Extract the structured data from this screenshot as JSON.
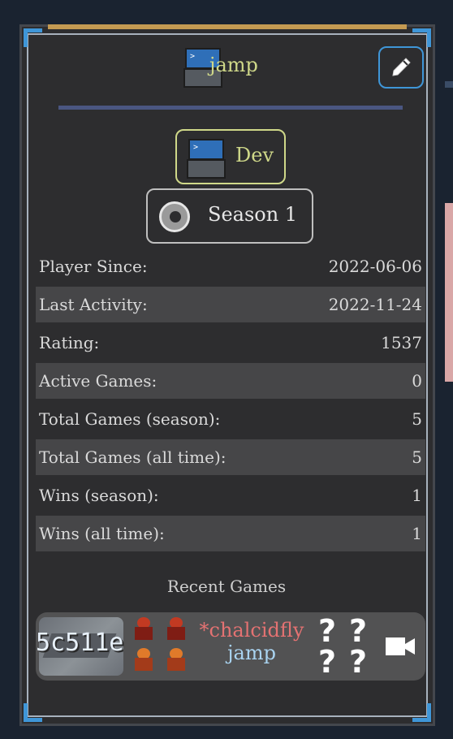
{
  "profile": {
    "username": "jamp",
    "dev_badge": "Dev",
    "season_badge": "Season 1"
  },
  "stats": [
    {
      "label": "Player Since:",
      "value": "2022-06-06"
    },
    {
      "label": "Last Activity:",
      "value": "2022-11-24"
    },
    {
      "label": "Rating:",
      "value": "1537"
    },
    {
      "label": "Active Games:",
      "value": "0"
    },
    {
      "label": "Total Games (season):",
      "value": "5"
    },
    {
      "label": "Total Games (all time):",
      "value": "5"
    },
    {
      "label": "Wins (season):",
      "value": "1"
    },
    {
      "label": "Wins (all time):",
      "value": "1"
    }
  ],
  "recent_games": {
    "title": "Recent Games",
    "games": [
      {
        "id": "5c511e",
        "player1": "*chalcidfly",
        "player2": "jamp",
        "unknown_marks": [
          "?",
          "?",
          "?",
          "?"
        ]
      }
    ]
  },
  "icons": {
    "avatar": "terminal-computer-icon",
    "edit": "pencil-icon",
    "season": "season-orb-icon",
    "replay": "video-camera-icon"
  },
  "colors": {
    "panel_bg": "#2d2d2f",
    "accent_blue": "#3f96d8",
    "username": "#cfd889",
    "player1": "#e47272",
    "player2": "#a9d3f0"
  }
}
